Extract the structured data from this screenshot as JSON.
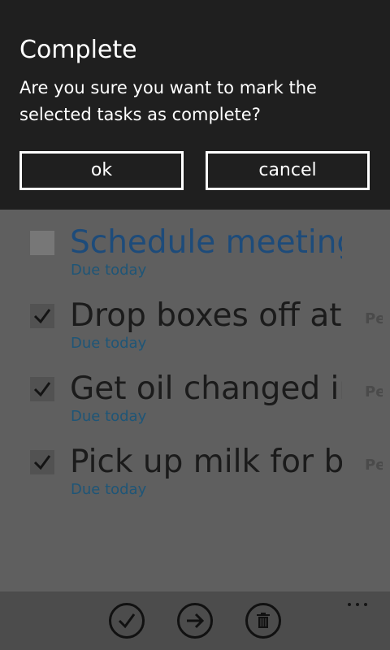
{
  "dialog": {
    "title": "Complete",
    "message": "Are you sure you want to mark the selected tasks as complete?",
    "ok_label": "ok",
    "cancel_label": "cancel"
  },
  "tasks": [
    {
      "title": "Schedule meeting",
      "due": "Due today",
      "owner": "",
      "checked": false
    },
    {
      "title": "Drop boxes off at p",
      "due": "Due today",
      "owner": "Pe",
      "checked": true
    },
    {
      "title": "Get oil changed in",
      "due": "Due today",
      "owner": "Pe",
      "checked": true
    },
    {
      "title": "Pick up milk for bre",
      "due": "Due today",
      "owner": "Pe",
      "checked": true
    }
  ],
  "app_bar": {
    "buttons": [
      "check-icon",
      "arrow-right-icon",
      "trash-icon"
    ],
    "more": "ellipsis-icon"
  },
  "colors": {
    "dialog_bg": "#1f1f1f",
    "accent": "#1d4b7a",
    "overlay_bg": "#5f5f5f"
  }
}
